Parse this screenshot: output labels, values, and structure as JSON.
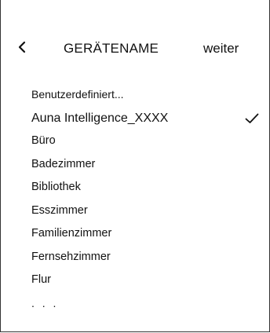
{
  "header": {
    "back_icon": "chevron-left-icon",
    "title": "GERÄTENAME",
    "next_label": "weiter"
  },
  "list": {
    "items": [
      {
        "label": "Benutzerdefiniert..."
      },
      {
        "label": "Auna Intelligence_XXXX",
        "selected": true
      },
      {
        "label": "Büro"
      },
      {
        "label": "Badezimmer"
      },
      {
        "label": "Bibliothek"
      },
      {
        "label": "Esszimmer"
      },
      {
        "label": "Familienzimmer"
      },
      {
        "label": "Fernsehzimmer"
      },
      {
        "label": "Flur"
      },
      {
        "label": ". . ."
      }
    ],
    "selected_icon": "checkmark-icon"
  }
}
